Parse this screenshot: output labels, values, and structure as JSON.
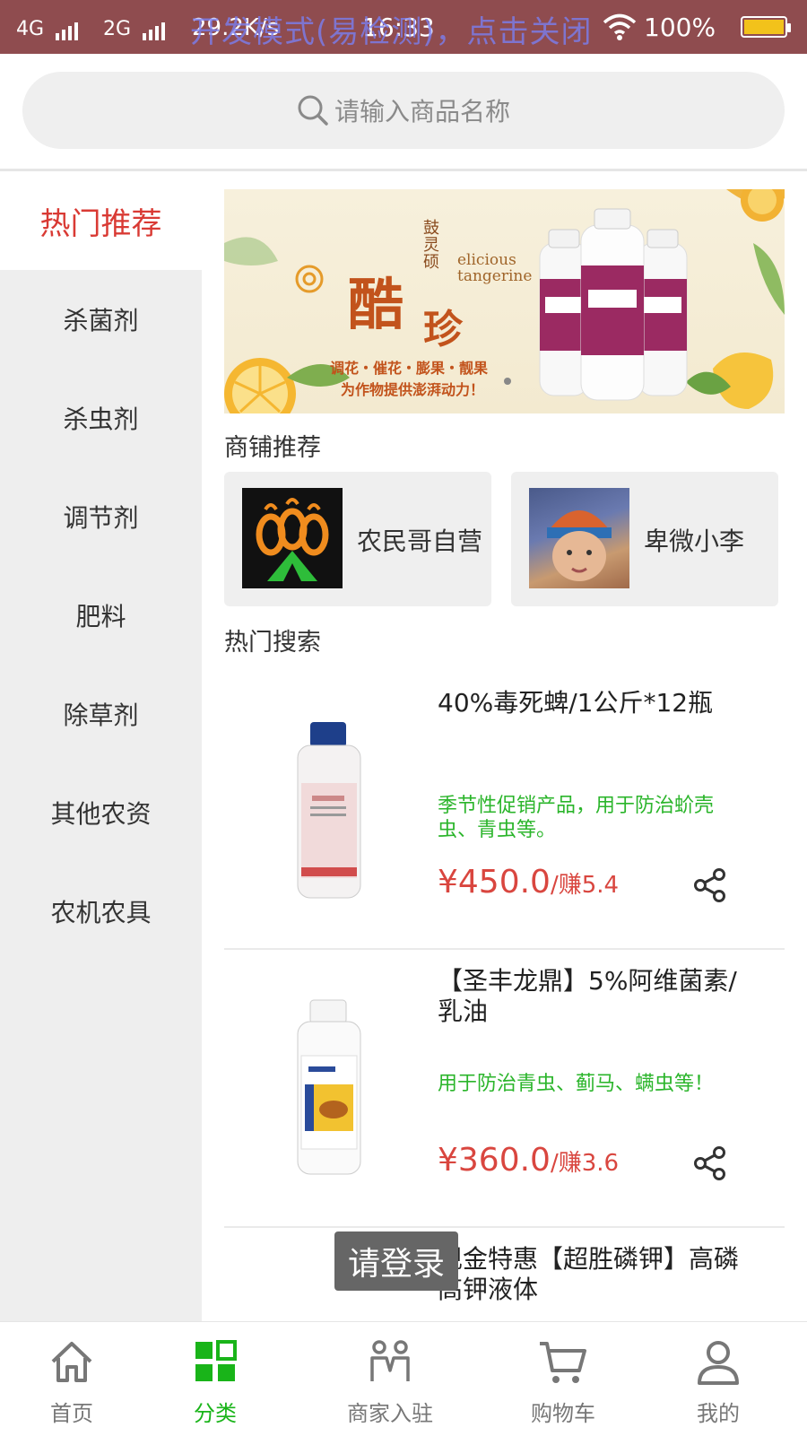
{
  "status_bar": {
    "network1": "4G",
    "network2": "2G",
    "speed": "29.2K/s",
    "time": "16:33",
    "overlay_text": "开发模式(易检测)，点击关闭",
    "battery": "100%"
  },
  "search": {
    "placeholder": "请输入商品名称"
  },
  "sidebar": {
    "active": "热门推荐",
    "items": [
      {
        "label": "杀菌剂"
      },
      {
        "label": "杀虫剂"
      },
      {
        "label": "调节剂"
      },
      {
        "label": "肥料"
      },
      {
        "label": "除草剂"
      },
      {
        "label": "其他农资"
      },
      {
        "label": "农机农具"
      }
    ]
  },
  "banner": {
    "brand_vertical": "鼓灵硕",
    "title_main": "酷",
    "title_sub": "珍",
    "english": "elicious tangerine",
    "slogan1": "调花・催花・膨果・靓果",
    "slogan2": "为作物提供澎湃动力！"
  },
  "shops": {
    "title": "商铺推荐",
    "items": [
      {
        "name": "农民哥自营"
      },
      {
        "name": "卑微小李"
      }
    ]
  },
  "hot_search": {
    "title": "热门搜索",
    "products": [
      {
        "title": "40%毒死蜱/1公斤*12瓶",
        "desc": "季节性促销产品，用于防治蚧壳虫、青虫等。",
        "price": "¥450.0",
        "earn": "/赚5.4"
      },
      {
        "title": "【圣丰龙鼎】5%阿维菌素/乳油",
        "desc": "用于防治青虫、蓟马、螨虫等！",
        "price": "¥360.0",
        "earn": "/赚3.6"
      },
      {
        "title": "现金特惠【超胜磷钾】高磷高钾液体"
      }
    ]
  },
  "toast": {
    "text": "请登录"
  },
  "tabbar": {
    "items": [
      {
        "label": "首页",
        "icon": "home-icon"
      },
      {
        "label": "分类",
        "icon": "category-icon"
      },
      {
        "label": "商家入驻",
        "icon": "merchant-icon"
      },
      {
        "label": "购物车",
        "icon": "cart-icon"
      },
      {
        "label": "我的",
        "icon": "user-icon"
      }
    ],
    "active_color": "#19b419"
  },
  "colors": {
    "status_bar": "#8f4c4f",
    "accent_red": "#d93a34",
    "price_red": "#d9463f",
    "desc_green": "#2bb52b"
  }
}
